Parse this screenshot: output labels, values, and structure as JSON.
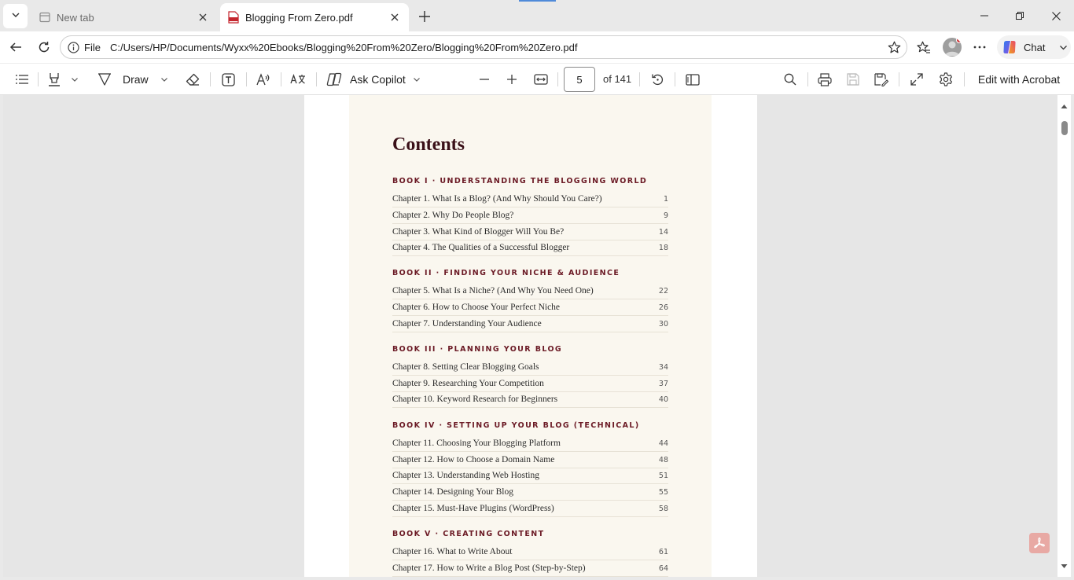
{
  "browser": {
    "tabs": [
      {
        "title": "New tab",
        "active": false
      },
      {
        "title": "Blogging From Zero.pdf",
        "active": true
      }
    ],
    "address": {
      "scheme": "File",
      "url": "C:/Users/HP/Documents/Wyxx%20Ebooks/Blogging%20From%20Zero/Blogging%20From%20Zero.pdf"
    },
    "chat_label": "Chat"
  },
  "pdf_toolbar": {
    "draw_label": "Draw",
    "copilot_label": "Ask Copilot",
    "current_page": "5",
    "page_total": "of 141",
    "edit_label": "Edit with Acrobat"
  },
  "document": {
    "title": "Contents",
    "books": [
      {
        "heading": "BOOK I · UNDERSTANDING THE BLOGGING WORLD",
        "chapters": [
          {
            "title": "Chapter 1. What Is a Blog? (And Why Should You Care?)",
            "page": "1"
          },
          {
            "title": "Chapter 2. Why Do People Blog?",
            "page": "9"
          },
          {
            "title": "Chapter 3. What Kind of Blogger Will You Be?",
            "page": "14"
          },
          {
            "title": "Chapter 4. The Qualities of a Successful Blogger",
            "page": "18"
          }
        ]
      },
      {
        "heading": "BOOK II · FINDING YOUR NICHE & AUDIENCE",
        "chapters": [
          {
            "title": "Chapter 5. What Is a Niche? (And Why You Need One)",
            "page": "22"
          },
          {
            "title": "Chapter 6. How to Choose Your Perfect Niche",
            "page": "26"
          },
          {
            "title": "Chapter 7. Understanding Your Audience",
            "page": "30"
          }
        ]
      },
      {
        "heading": "BOOK III · PLANNING YOUR BLOG",
        "chapters": [
          {
            "title": "Chapter 8. Setting Clear Blogging Goals",
            "page": "34"
          },
          {
            "title": "Chapter 9. Researching Your Competition",
            "page": "37"
          },
          {
            "title": "Chapter 10. Keyword Research for Beginners",
            "page": "40"
          }
        ]
      },
      {
        "heading": "BOOK IV · SETTING UP YOUR BLOG (TECHNICAL)",
        "chapters": [
          {
            "title": "Chapter 11. Choosing Your Blogging Platform",
            "page": "44"
          },
          {
            "title": "Chapter 12. How to Choose a Domain Name",
            "page": "48"
          },
          {
            "title": "Chapter 13. Understanding Web Hosting",
            "page": "51"
          },
          {
            "title": "Chapter 14. Designing Your Blog",
            "page": "55"
          },
          {
            "title": "Chapter 15. Must-Have Plugins (WordPress)",
            "page": "58"
          }
        ]
      },
      {
        "heading": "BOOK V · CREATING CONTENT",
        "chapters": [
          {
            "title": "Chapter 16. What to Write About",
            "page": "61"
          },
          {
            "title": "Chapter 17. How to Write a Blog Post (Step-by-Step)",
            "page": "64"
          }
        ]
      }
    ]
  },
  "colors": {
    "heading": "#3a1018",
    "book_heading": "#6b1a25",
    "page_tint": "#faf7ef",
    "accent": "#4f8ad9"
  }
}
